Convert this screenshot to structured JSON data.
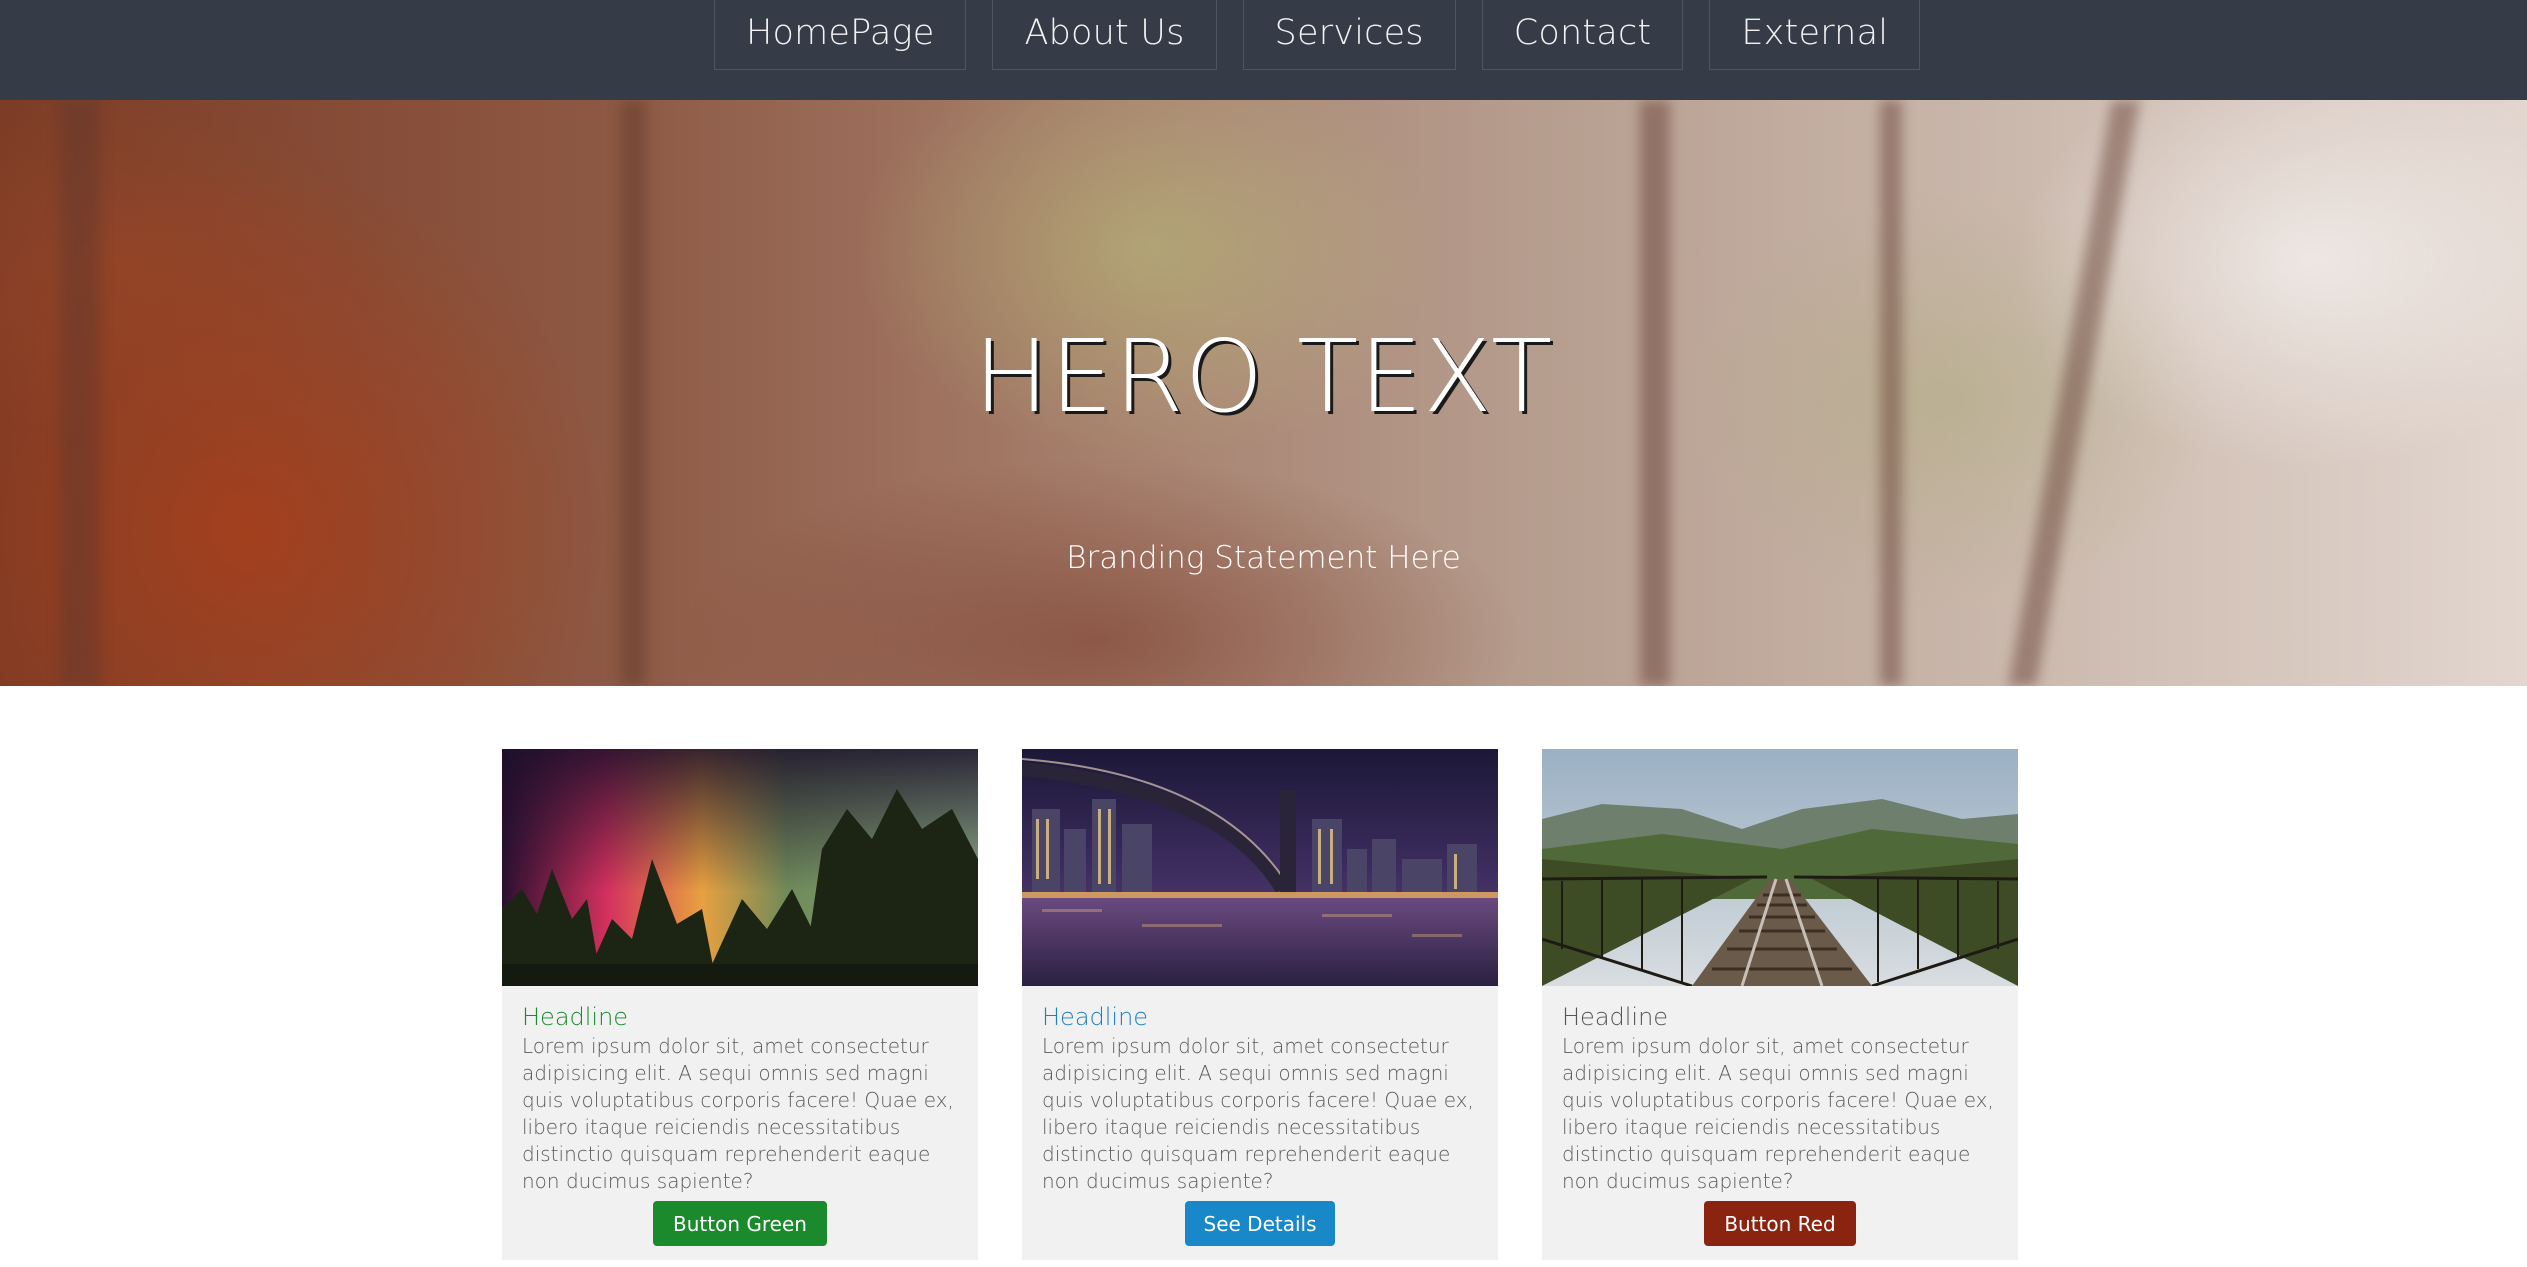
{
  "nav": {
    "items": [
      "HomePage",
      "About Us",
      "Services",
      "Contact",
      "External"
    ]
  },
  "hero": {
    "title": "HERO TEXT",
    "subtitle": "Branding Statement Here"
  },
  "cards": [
    {
      "headline": "Headline",
      "headline_color": "#1a8a2c",
      "body": "Lorem ipsum dolor sit, amet consectetur adipisicing elit. A sequi omnis sed magni quis voluptatibus corporis facere! Quae ex, libero itaque reiciendis necessitatibus distinctio quisquam reprehenderit eaque non ducimus sapiente?",
      "button_label": "Button Green",
      "button_color": "#1a8a2c"
    },
    {
      "headline": "Headline",
      "headline_color": "#1b7fc0",
      "body": "Lorem ipsum dolor sit, amet consectetur adipisicing elit. A sequi omnis sed magni quis voluptatibus corporis facere! Quae ex, libero itaque reiciendis necessitatibus distinctio quisquam reprehenderit eaque non ducimus sapiente?",
      "button_label": "See Details",
      "button_color": "#1888c8"
    },
    {
      "headline": "Headline",
      "headline_color": "#555555",
      "body": "Lorem ipsum dolor sit, amet consectetur adipisicing elit. A sequi omnis sed magni quis voluptatibus corporis facere! Quae ex, libero itaque reiciendis necessitatibus distinctio quisquam reprehenderit eaque non ducimus sapiente?",
      "button_label": "Button Red",
      "button_color": "#8a2410"
    }
  ]
}
